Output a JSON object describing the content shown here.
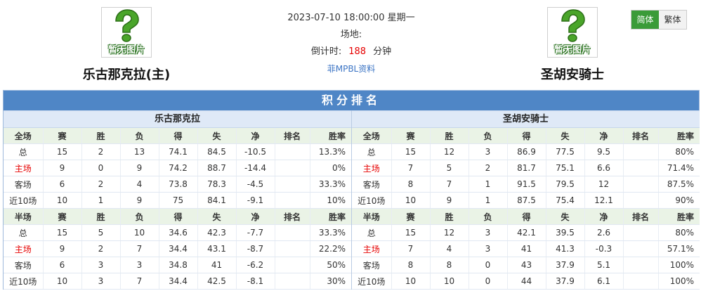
{
  "home_team": {
    "name": "乐古那克拉(主)",
    "logo_text": "暂无图片"
  },
  "away_team": {
    "name": "圣胡安骑士",
    "logo_text": "暂无图片"
  },
  "match": {
    "datetime": "2023-07-10 18:00:00 星期一",
    "venue_label": "场地:",
    "countdown_label": "倒计时:",
    "countdown_value": "188",
    "countdown_unit": "分钟",
    "league_link": "菲MPBL资料"
  },
  "lang": {
    "simplified": "简体",
    "traditional": "繁体"
  },
  "standings": {
    "title": "积分排名",
    "columns_full": [
      "全场",
      "赛",
      "胜",
      "负",
      "得",
      "失",
      "净",
      "排名",
      "胜率"
    ],
    "columns_half": [
      "半场",
      "赛",
      "胜",
      "负",
      "得",
      "失",
      "净",
      "排名",
      "胜率"
    ],
    "teams": [
      {
        "name": "乐古那克拉",
        "full": [
          [
            "总",
            "15",
            "2",
            "13",
            "74.1",
            "84.5",
            "-10.5",
            "",
            "13.3%"
          ],
          [
            "主场",
            "9",
            "0",
            "9",
            "74.2",
            "88.7",
            "-14.4",
            "",
            "0%"
          ],
          [
            "客场",
            "6",
            "2",
            "4",
            "73.8",
            "78.3",
            "-4.5",
            "",
            "33.3%"
          ],
          [
            "近10场",
            "10",
            "1",
            "9",
            "75",
            "84.1",
            "-9.1",
            "",
            "10%"
          ]
        ],
        "half": [
          [
            "总",
            "15",
            "5",
            "10",
            "34.6",
            "42.3",
            "-7.7",
            "",
            "33.3%"
          ],
          [
            "主场",
            "9",
            "2",
            "7",
            "34.4",
            "43.1",
            "-8.7",
            "",
            "22.2%"
          ],
          [
            "客场",
            "6",
            "3",
            "3",
            "34.8",
            "41",
            "-6.2",
            "",
            "50%"
          ],
          [
            "近10场",
            "10",
            "3",
            "7",
            "34.4",
            "42.5",
            "-8.1",
            "",
            "30%"
          ]
        ]
      },
      {
        "name": "圣胡安骑士",
        "full": [
          [
            "总",
            "15",
            "12",
            "3",
            "86.9",
            "77.5",
            "9.5",
            "",
            "80%"
          ],
          [
            "主场",
            "7",
            "5",
            "2",
            "81.7",
            "75.1",
            "6.6",
            "",
            "71.4%"
          ],
          [
            "客场",
            "8",
            "7",
            "1",
            "91.5",
            "79.5",
            "12",
            "",
            "87.5%"
          ],
          [
            "近10场",
            "10",
            "9",
            "1",
            "87.5",
            "75.4",
            "12.1",
            "",
            "90%"
          ]
        ],
        "half": [
          [
            "总",
            "15",
            "12",
            "3",
            "42.1",
            "39.5",
            "2.6",
            "",
            "80%"
          ],
          [
            "主场",
            "7",
            "4",
            "3",
            "41",
            "41.3",
            "-0.3",
            "",
            "57.1%"
          ],
          [
            "客场",
            "8",
            "8",
            "0",
            "43",
            "37.9",
            "5.1",
            "",
            "100%"
          ],
          [
            "近10场",
            "10",
            "10",
            "0",
            "44",
            "37.9",
            "6.1",
            "",
            "100%"
          ]
        ]
      }
    ]
  }
}
